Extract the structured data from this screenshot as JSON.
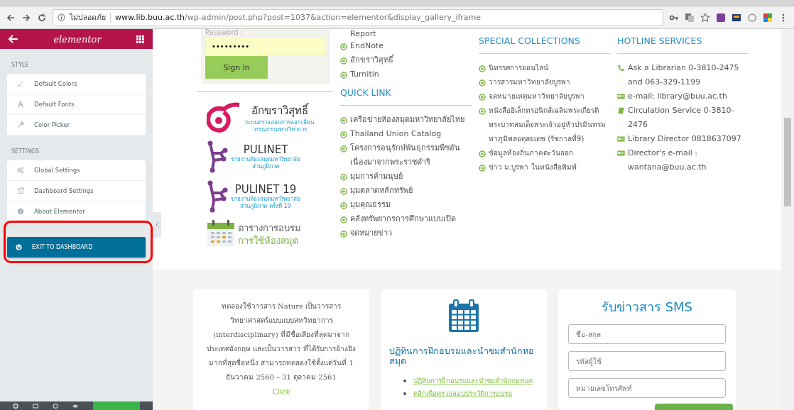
{
  "browser": {
    "security_label": "ไม่ปลอดภัย",
    "url_host": "www.lib.buu.ac.th",
    "url_path": "/wp-admin/post.php?post=1037&action=elementor&display_gallery_iframe"
  },
  "sidebar": {
    "logo": "elementor",
    "sections": [
      {
        "title": "STYLE",
        "items": [
          {
            "kind": "brush",
            "label": "Default Colors"
          },
          {
            "kind": "font",
            "label": "Default Fonts"
          },
          {
            "kind": "picker",
            "label": "Color Picker"
          }
        ]
      },
      {
        "title": "SETTINGS",
        "items": [
          {
            "kind": "gears",
            "label": "Global Settings"
          },
          {
            "kind": "external",
            "label": "Dashboard Settings"
          },
          {
            "kind": "info",
            "label": "About Elementor"
          }
        ]
      }
    ],
    "exit_button": "EXIT TO DASHBOARD",
    "highlighted": true
  },
  "login": {
    "password_label": "Password :",
    "password_value": "•••••••••",
    "sign_in": "Sign In"
  },
  "logos": [
    {
      "kind": "swirl",
      "title": "อักขราวิสุทธิ์",
      "subtitle": [
        "ระบบตรวจสอบการลอกเลียน",
        "วรรณกรรมทางวิชาการ"
      ]
    },
    {
      "kind": "network",
      "title": "PULINET",
      "subtitle": [
        "ข่ายงานห้องสมุดมหาวิทยาลัย",
        "ส่วนภูมิภาค"
      ]
    },
    {
      "kind": "network",
      "title": "PULINET  19",
      "subtitle": [
        "ข่ายงานห้องสมุดมหาวิทยาลัย",
        "ส่วนภูมิภาค ครั้งที่ 19"
      ]
    },
    {
      "kind": "calendar",
      "title": "ตารางการอบรม",
      "subtitle": [
        "การใช้ห้องสมุด"
      ]
    }
  ],
  "tools": {
    "continued": "Report",
    "items": [
      "EndNote",
      "อักขราวิสุทธิ์",
      "Turnitin"
    ]
  },
  "quick_link": {
    "title": "QUICK LINK",
    "items": [
      "เครือข่ายห้องสมุดมหาวิทยาลัยไทย",
      "Thailand Union Catalog",
      "โครงการอนุรักษ์พันธุกรรมพืชอันเนื่องมาจากพระราชดำริ",
      "มุมการค้ามนุษย์",
      "มุมตลาดหลักทรัพย์",
      "มุมคุณธรรม",
      "คลังทรัพยากรการศึกษาแบบเปิด",
      "จดหมายข่าว"
    ]
  },
  "special_collections": {
    "title": "SPECIAL COLLECTIONS",
    "items": [
      "นิทรรศการออนไลน์",
      "วารสารมหาวิทยาลัยบูรพา",
      "จดหมายเหตุมหาวิทยาลัยบูรพา",
      "หนังสืออิเล็กทรอนิกส์เฉลิมพระเกียรติพระบาทสมเด็จพระเจ้าอยู่หัวปรมินทรมหาภูมิพลอดุลยเดช (รัชกาลที่9)",
      "ข้อมูลท้องถิ่นภาคตะวันออก",
      "ข่าว ม.บูรพา ในหนังสือพิมพ์"
    ]
  },
  "hotline": {
    "title": "HOTLINE SERVICES",
    "items": [
      {
        "kind": "phone",
        "text": "Ask a Librarian 0-3810-2475 and 063-329-1199"
      },
      {
        "kind": "card",
        "text": "e-mail: library@buu.ac.th"
      },
      {
        "kind": "book",
        "text": "Circulation Service 0-3810-2476"
      },
      {
        "kind": "card",
        "text": "Library Director 0818637097"
      },
      {
        "kind": "card",
        "text": "Director's e-mail : wantana@buu.ac.th"
      }
    ]
  },
  "nature_card": {
    "text": "ทดลองใช้วารสาร Nature เป็นวารสารวิทยาศาสตร์แบบแบบสหวิทยาการ (interdisciplinary) ที่มีชื่อเสียงที่สุดมาจากประเทศอังกฤษ และเป็นวารสาร ที่ได้รับการอ้างอิงมากที่สุดชื่อหนึ่ง สามารถทดลองใช้ตั้งแต่วันที่ 1 ธันวาคม 2560 – 31 ตุลาคม 2561",
    "link": "Click"
  },
  "training_card": {
    "title": "ปฏิทินการฝึกอบรมและนำชมสำนักหอสมุด",
    "links": [
      "ปฏิทินการฝึกอบรมและนำชมสำนักหอสมุด",
      "คลิกเพื่อตรวจสอบประวัติการอบรม"
    ]
  },
  "sms_card": {
    "title": "รับข่าวสาร SMS",
    "fields": [
      {
        "placeholder": "ชื่อ-สกุล"
      },
      {
        "placeholder": "รหัสผู้ใช้"
      },
      {
        "placeholder": "หมายเลขโทรศัพท์"
      }
    ]
  }
}
